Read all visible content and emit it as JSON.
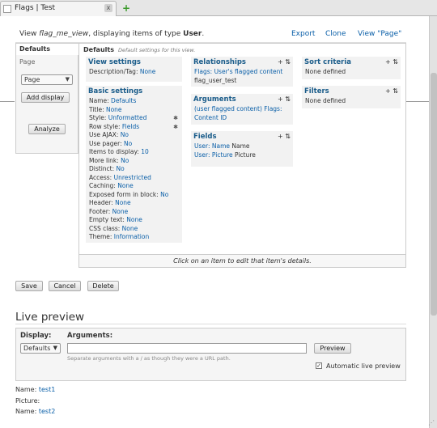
{
  "browser": {
    "tab_title": "Flags | Test",
    "tab_close": "x",
    "new_tab": "+"
  },
  "header": {
    "prefix": "View ",
    "view_name": "flag_me_view",
    "middle": ", displaying items of type ",
    "type": "User",
    "suffix": ".",
    "export": "Export",
    "clone": "Clone",
    "view_page": "View \"Page\""
  },
  "sidebar": {
    "defaults_tab": "Defaults",
    "page_tab": "Page",
    "display_select": "Page",
    "add_display": "Add display",
    "analyze": "Analyze"
  },
  "panel": {
    "title": "Defaults",
    "description": "Default settings for this view.",
    "footer": "Click on an item to edit that item's details."
  },
  "view_settings": {
    "heading": "View settings",
    "desc_label": "Description/Tag: ",
    "desc_value": "None"
  },
  "basic_settings": {
    "heading": "Basic settings",
    "rows": [
      {
        "label": "Name: ",
        "value": "Defaults"
      },
      {
        "label": "Title: ",
        "value": "None"
      },
      {
        "label": "Style: ",
        "value": "Unformatted"
      },
      {
        "label": "Row style: ",
        "value": "Fields"
      },
      {
        "label": "Use AJAX: ",
        "value": "No"
      },
      {
        "label": "Use pager: ",
        "value": "No"
      },
      {
        "label": "Items to display: ",
        "value": "10"
      },
      {
        "label": "More link: ",
        "value": "No"
      },
      {
        "label": "Distinct: ",
        "value": "No"
      },
      {
        "label": "Access: ",
        "value": "Unrestricted"
      },
      {
        "label": "Caching: ",
        "value": "None"
      },
      {
        "label": "Exposed form in block: ",
        "value": "No"
      },
      {
        "label": "Header: ",
        "value": "None"
      },
      {
        "label": "Footer: ",
        "value": "None"
      },
      {
        "label": "Empty text: ",
        "value": "None"
      },
      {
        "label": "CSS class: ",
        "value": "None"
      },
      {
        "label": "Theme: ",
        "value": "Information"
      }
    ]
  },
  "relationships": {
    "heading": "Relationships",
    "link": "Flags: User's flagged content",
    "sub": "flag_user_test"
  },
  "arguments_box": {
    "heading": "Arguments",
    "link": "(user flagged content) Flags: Content ID"
  },
  "fields": {
    "heading": "Fields",
    "rows": [
      {
        "link": "User: Name",
        "text": " Name"
      },
      {
        "link": "User: Picture",
        "text": " Picture"
      }
    ]
  },
  "sort_criteria": {
    "heading": "Sort criteria",
    "value": "None defined"
  },
  "filters": {
    "heading": "Filters",
    "value": "None defined"
  },
  "tools": {
    "add": "+",
    "rearrange": "⇅",
    "gear": "✱"
  },
  "form_buttons": {
    "save": "Save",
    "cancel": "Cancel",
    "delete": "Delete"
  },
  "live_preview": {
    "heading": "Live preview",
    "display_label": "Display:",
    "display_value": "Defaults",
    "arguments_label": "Arguments:",
    "arguments_value": "",
    "help": "Separate arguments with a / as though they were a URL path.",
    "preview_button": "Preview",
    "auto_label": "Automatic live preview",
    "auto_checked": "✓"
  },
  "results": [
    {
      "label": "Name: ",
      "value": "test1"
    },
    {
      "label": "Picture:",
      "value": ""
    },
    {
      "label": "Name: ",
      "value": "test2"
    }
  ]
}
